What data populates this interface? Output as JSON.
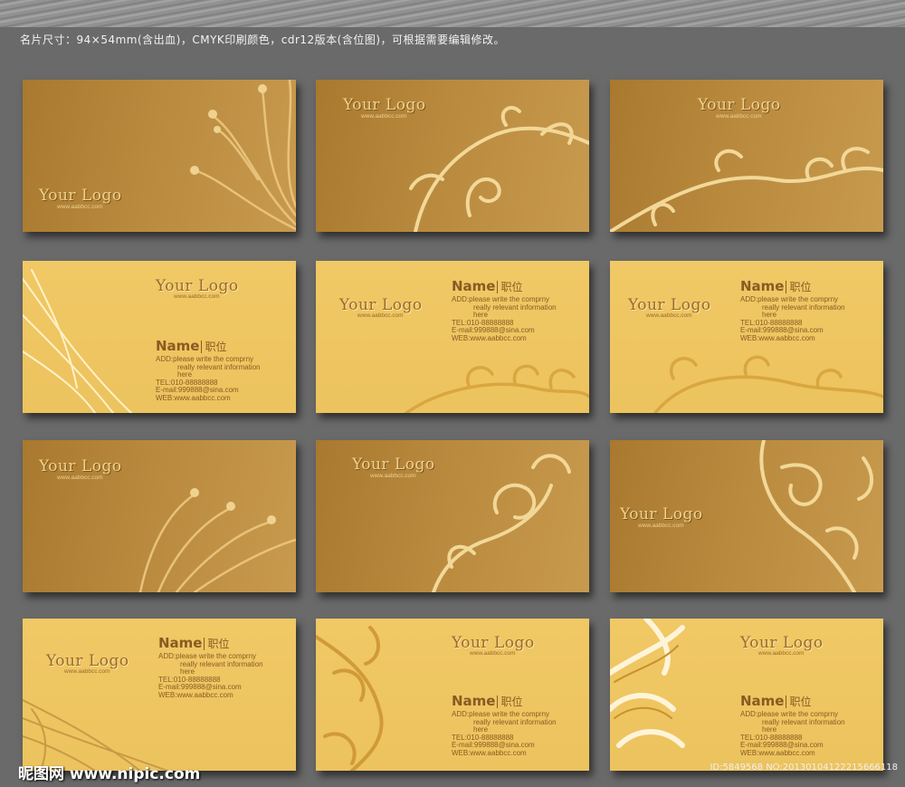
{
  "caption": "名片尺寸：94×54mm(含出血)，CMYK印刷颜色，cdr12版本(含位图)，可根据需要编辑修改。",
  "cards": [
    {
      "logo": "Your Logo",
      "url": "www.aabbcc.com"
    },
    {
      "logo": "Your Logo",
      "url": "www.aabbcc.com"
    },
    {
      "logo": "Your Logo",
      "url": "www.aabbcc.com"
    },
    {
      "logo": "Your Logo",
      "url": "www.aabbcc.com",
      "name": "Name",
      "title": "职位",
      "add1": "ADD:please write the comprny",
      "add2": "really relevant information",
      "add3": "here",
      "tel": "TEL:010-88888888",
      "email": "E-mail:999888@sina.com",
      "web": "WEB:www.aabbcc.com"
    },
    {
      "logo": "Your Logo",
      "url": "www.aabbcc.com",
      "name": "Name",
      "title": "职位",
      "add1": "ADD:please write the comprny",
      "add2": "really relevant information",
      "add3": "here",
      "tel": "TEL:010-88888888",
      "email": "E-mail:999888@sina.com",
      "web": "WEB:www.aabbcc.com"
    },
    {
      "logo": "Your Logo",
      "url": "www.aabbcc.com",
      "name": "Name",
      "title": "职位",
      "add1": "ADD:please write the comprny",
      "add2": "really relevant information",
      "add3": "here",
      "tel": "TEL:010-88888888",
      "email": "E-mail:999888@sina.com",
      "web": "WEB:www.aabbcc.com"
    },
    {
      "logo": "Your Logo",
      "url": "www.aabbcc.com"
    },
    {
      "logo": "Your Logo",
      "url": "www.aabbcc.com"
    },
    {
      "logo": "Your Logo",
      "url": "www.aabbcc.com"
    },
    {
      "logo": "Your Logo",
      "url": "www.aabbcc.com",
      "name": "Name",
      "title": "职位",
      "add1": "ADD:please write the comprny",
      "add2": "really relevant information",
      "add3": "here",
      "tel": "TEL:010-88888888",
      "email": "E-mail:999888@sina.com",
      "web": "WEB:www.aabbcc.com"
    },
    {
      "logo": "Your Logo",
      "url": "www.aabbcc.com",
      "name": "Name",
      "title": "职位",
      "add1": "ADD:please write the comprny",
      "add2": "really relevant information",
      "add3": "here",
      "tel": "TEL:010-88888888",
      "email": "E-mail:999888@sina.com",
      "web": "WEB:www.aabbcc.com"
    },
    {
      "logo": "Your Logo",
      "url": "www.aabbcc.com",
      "name": "Name",
      "title": "职位",
      "add1": "ADD:please write the comprny",
      "add2": "really relevant information",
      "add3": "here",
      "tel": "TEL:010-88888888",
      "email": "E-mail:999888@sina.com",
      "web": "WEB:www.aabbcc.com"
    }
  ],
  "watermark_left": "昵图网 www.nipic.com",
  "watermark_right": "ID:5849568 NO:20130104122215666118",
  "colors": {
    "dark_card": "#b5863a",
    "light_card": "#eec462",
    "text_brown": "#8a5a22",
    "background": "#6a6a6a"
  }
}
